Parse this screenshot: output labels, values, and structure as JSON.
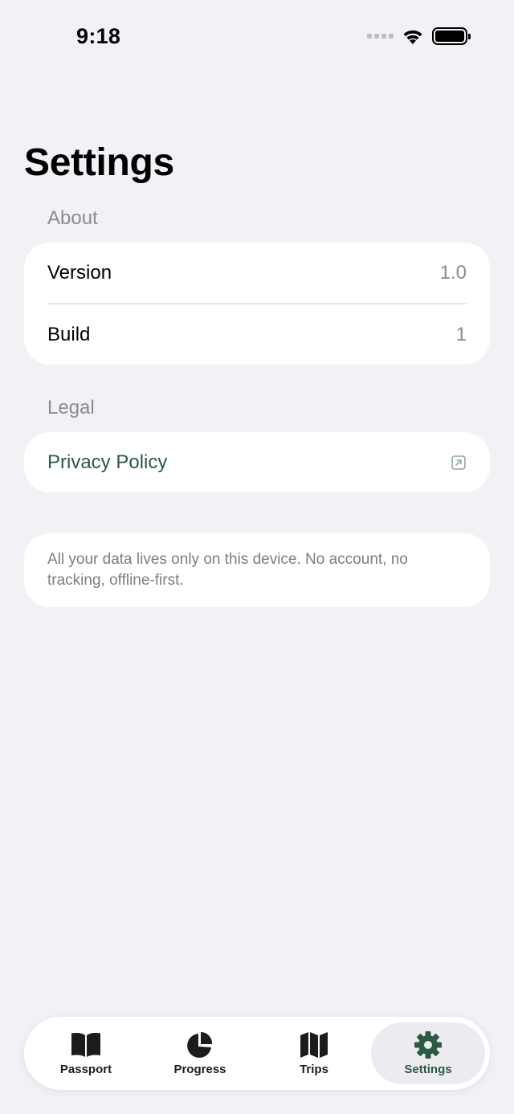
{
  "status_bar": {
    "time": "9:18"
  },
  "page_title": "Settings",
  "sections": {
    "about": {
      "header": "About",
      "rows": [
        {
          "label": "Version",
          "value": "1.0"
        },
        {
          "label": "Build",
          "value": "1"
        }
      ]
    },
    "legal": {
      "header": "Legal",
      "privacy_label": "Privacy Policy"
    }
  },
  "footer_note": "All your data lives only on this device. No account, no tracking, offline-first.",
  "tabs": [
    {
      "label": "Passport",
      "icon": "book-icon",
      "active": false
    },
    {
      "label": "Progress",
      "icon": "pie-chart-icon",
      "active": false
    },
    {
      "label": "Trips",
      "icon": "map-icon",
      "active": false
    },
    {
      "label": "Settings",
      "icon": "gear-icon",
      "active": true
    }
  ],
  "colors": {
    "accent": "#2b5a43",
    "background": "#f1f1f6",
    "secondary_text": "#8a8a8f"
  }
}
